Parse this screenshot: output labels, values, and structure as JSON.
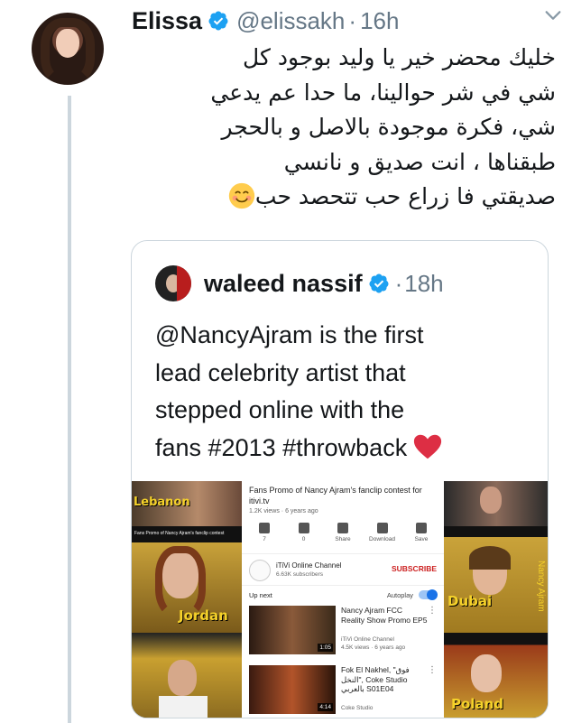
{
  "tweet": {
    "author_name": "Elissa",
    "author_handle": "@elissakh",
    "separator": "·",
    "time": "16h",
    "text_lines": [
      "خليك محضر خير يا وليد بوجود كل",
      "شي في شر حوالينا، ما حدا عم يدعي",
      "شي، فكرة موجودة بالاصل و بالحجر",
      "طبقناها ،  انت صديق و نانسي",
      "صديقتي فا زراع حب تتحصد حب"
    ],
    "emoji": "smiling-face"
  },
  "quoted": {
    "author_name": "waleed nassif",
    "separator": "·",
    "time": "18h",
    "text_lines": [
      "@NancyAjram is the first",
      "lead celebrity artist that",
      "stepped online with the",
      "fans #2013 #throwback"
    ],
    "emoji": "red-heart"
  },
  "media": {
    "youtube": {
      "title": "Fans Promo of Nancy Ajram's fanclip contest for itivi.tv",
      "views": "1.2K views · 6 years ago",
      "actions": [
        {
          "count": "7",
          "label": ""
        },
        {
          "count": "0",
          "label": ""
        },
        {
          "count": "",
          "label": "Share"
        },
        {
          "count": "",
          "label": "Download"
        },
        {
          "count": "",
          "label": "Save"
        }
      ],
      "channel_name": "iTiVi Online Channel",
      "channel_subs": "6.63K subscribers",
      "subscribe": "SUBSCRIBE",
      "up_next": "Up next",
      "autoplay": "Autoplay",
      "items": [
        {
          "title": "Nancy Ajram FCC Reality Show Promo EP5",
          "channel": "iTiVi Online Channel",
          "views": "4.5K views · 6 years ago",
          "duration": "1:05"
        },
        {
          "title": "Fok El Nakhel, \"فوق النخل\", Coke Studio بالعربي S01E04",
          "channel": "Coke Studio",
          "views": "",
          "duration": "4:14"
        }
      ]
    },
    "side_panels": {
      "left_labels": [
        "Lebanon",
        "Jordan"
      ],
      "right_labels": [
        "Dubai",
        "Poland",
        "Nancy Ajram"
      ],
      "small_caption": "Fans Promo of Nancy Ajram's fanclip contest"
    }
  },
  "colors": {
    "text": "#14171a",
    "secondary": "#657786",
    "border": "#ccd6dd",
    "verified": "#1da1f2",
    "subscribe": "#cc1f1f"
  }
}
